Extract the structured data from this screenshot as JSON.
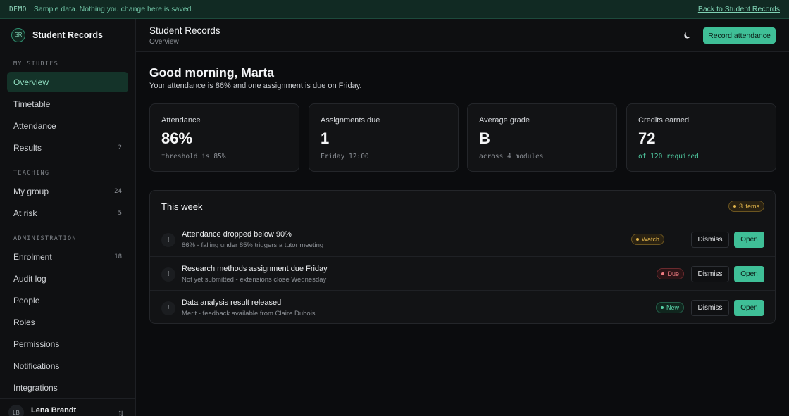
{
  "banner": {
    "tag": "DEMO",
    "message": "Sample data. Nothing you change here is saved.",
    "back_link": "Back to Student Records"
  },
  "brand": {
    "logo": "SR",
    "name": "Student Records"
  },
  "sidebar": {
    "sections": [
      {
        "label": "MY STUDIES",
        "items": [
          {
            "label": "Overview",
            "count": "",
            "active": true
          },
          {
            "label": "Timetable",
            "count": ""
          },
          {
            "label": "Attendance",
            "count": ""
          },
          {
            "label": "Results",
            "count": "2"
          }
        ]
      },
      {
        "label": "TEACHING",
        "items": [
          {
            "label": "My group",
            "count": "24"
          },
          {
            "label": "At risk",
            "count": "5"
          }
        ]
      },
      {
        "label": "ADMINISTRATION",
        "items": [
          {
            "label": "Enrolment",
            "count": "18"
          },
          {
            "label": "Audit log",
            "count": ""
          },
          {
            "label": "People",
            "count": ""
          },
          {
            "label": "Roles",
            "count": ""
          },
          {
            "label": "Permissions",
            "count": ""
          },
          {
            "label": "Notifications",
            "count": ""
          },
          {
            "label": "Integrations",
            "count": ""
          }
        ]
      }
    ],
    "user": {
      "initials": "LB",
      "name": "Lena Brandt",
      "switch_icon": "swap-icon"
    }
  },
  "header": {
    "title": "Student Records",
    "breadcrumb": "Overview",
    "theme_icon": "moon-icon",
    "primary_button": "Record attendance"
  },
  "main": {
    "greeting": "Good morning, Marta",
    "subtitle": "Your attendance is 86% and one assignment is due on Friday.",
    "cards": [
      {
        "label": "Attendance",
        "value": "86%",
        "note": "threshold is 85%",
        "note_good": false
      },
      {
        "label": "Assignments due",
        "value": "1",
        "note": "Friday 12:00",
        "note_good": false
      },
      {
        "label": "Average grade",
        "value": "B",
        "note": "across 4 modules",
        "note_good": false
      },
      {
        "label": "Credits earned",
        "value": "72",
        "note": "of 120 required",
        "note_good": true
      }
    ],
    "week": {
      "title": "This week",
      "count_badge": "3 items",
      "items": [
        {
          "icon": "!",
          "title": "Attendance dropped below 90%",
          "subtitle": "86% - falling under 85% triggers a tutor meeting",
          "status": "Watch",
          "status_kind": "watch",
          "dismiss": "Dismiss",
          "open": "Open"
        },
        {
          "icon": "!",
          "title": "Research methods assignment due Friday",
          "subtitle": "Not yet submitted - extensions close Wednesday",
          "status": "Due",
          "status_kind": "due",
          "dismiss": "Dismiss",
          "open": "Open"
        },
        {
          "icon": "!",
          "title": "Data analysis result released",
          "subtitle": "Merit - feedback available from Claire Dubois",
          "status": "New",
          "status_kind": "new",
          "dismiss": "Dismiss",
          "open": "Open"
        }
      ]
    }
  },
  "colors": {
    "accent": "#3fbf97",
    "watch": "#e3b64c",
    "due": "#ee7b81",
    "new": "#58d0a6",
    "background": "#0b0c0e"
  }
}
